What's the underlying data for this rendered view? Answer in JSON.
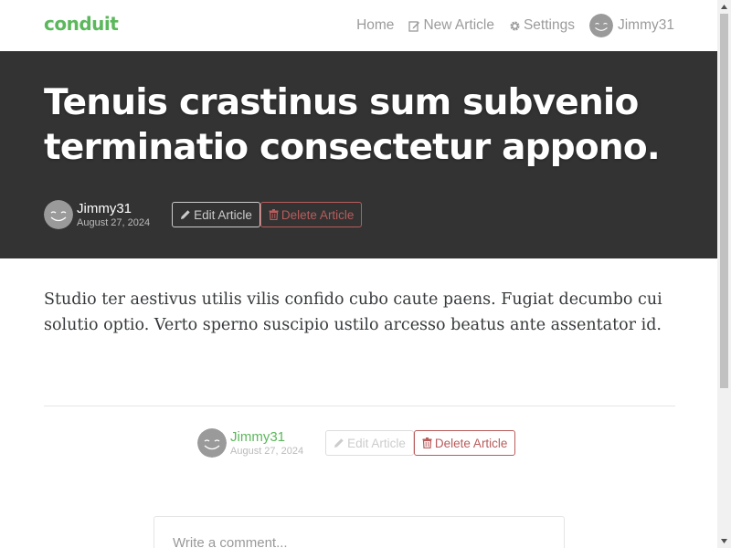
{
  "navbar": {
    "brand": "conduit",
    "items": [
      {
        "label": "Home",
        "icon": "none"
      },
      {
        "label": "New Article",
        "icon": "edit-icon"
      },
      {
        "label": "Settings",
        "icon": "gear-icon"
      },
      {
        "label": "Jimmy31",
        "icon": "avatar"
      }
    ]
  },
  "article": {
    "title": "Tenuis crastinus sum subvenio terminatio consectetur appono.",
    "author": "Jimmy31",
    "date": "August 27, 2024",
    "body": "Studio ter aestivus utilis vilis confido cubo caute paens. Fugiat decumbo cui solutio optio. Verto sperno suscipio ustilo arcesso beatus ante assentator id.",
    "edit_label": "Edit Article",
    "delete_label": "Delete Article"
  },
  "comment": {
    "placeholder": "Write a comment..."
  },
  "colors": {
    "brand": "#5cb85c",
    "banner": "#333333",
    "danger": "#b85c5c"
  }
}
